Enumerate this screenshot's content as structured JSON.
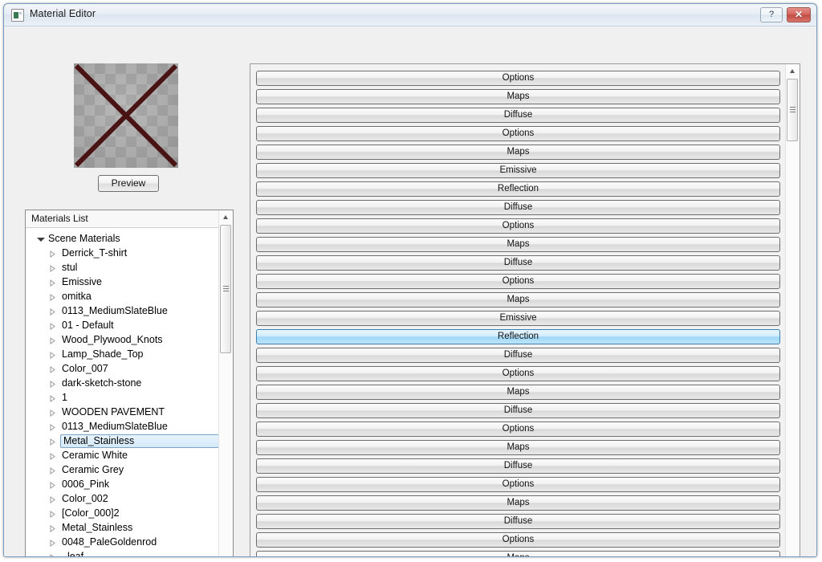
{
  "window": {
    "title": "Material Editor",
    "icon": "material-editor-icon",
    "help_label": "?",
    "close_label": "✕",
    "accent_color": "#7a9bbd",
    "close_color": "#c14a43"
  },
  "preview": {
    "button_label": "Preview",
    "swatch_description": "gray-textured-material-with-red-x",
    "x_color": "#4a1313",
    "base_color": "#a6a6a6"
  },
  "materials": {
    "header": "Materials List",
    "root": "Scene Materials",
    "selected": "Metal_Stainless",
    "items": [
      "Derrick_T-shirt",
      "stul",
      "Emissive",
      "omitka",
      "0113_MediumSlateBlue",
      "01 - Default",
      "Wood_Plywood_Knots",
      "Lamp_Shade_Top",
      "Color_007",
      "dark-sketch-stone",
      "1",
      "WOODEN PAVEMENT",
      "0113_MediumSlateBlue",
      "Metal_Stainless",
      "Ceramic White",
      "Ceramic Grey",
      "0006_Pink",
      "Color_002",
      "[Color_000]2",
      "Metal_Stainless",
      "0048_PaleGoldenrod",
      "_leaf"
    ]
  },
  "property_panel": {
    "hovered_index": 14,
    "hover_color": "#9fd8f7",
    "buttons": [
      "Options",
      "Maps",
      "Diffuse",
      "Options",
      "Maps",
      "Emissive",
      "Reflection",
      "Diffuse",
      "Options",
      "Maps",
      "Diffuse",
      "Options",
      "Maps",
      "Emissive",
      "Reflection",
      "Diffuse",
      "Options",
      "Maps",
      "Diffuse",
      "Options",
      "Maps",
      "Diffuse",
      "Options",
      "Maps",
      "Diffuse",
      "Options",
      "Maps"
    ]
  },
  "scrollbars": {
    "up_arrow": "▲",
    "down_arrow": "▼"
  }
}
